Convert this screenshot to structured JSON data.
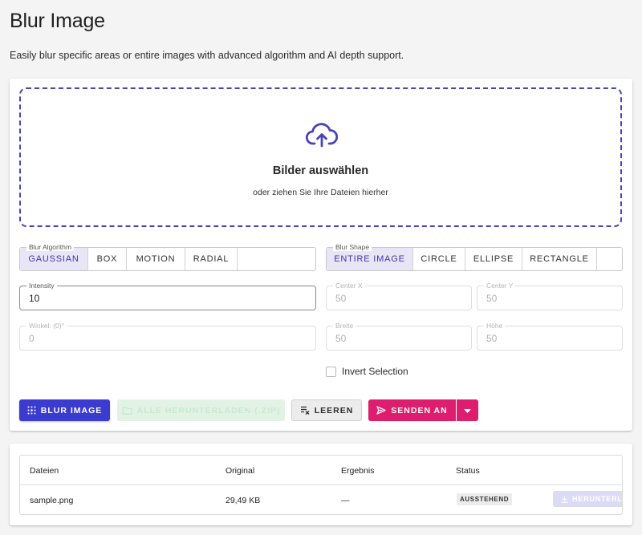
{
  "header": {
    "title": "Blur Image",
    "description": "Easily blur specific areas or entire images with advanced algorithm and AI depth support."
  },
  "dropzone": {
    "title": "Bilder auswählen",
    "subtitle": "oder ziehen Sie Ihre Dateien hierher",
    "icon": "cloud-upload-icon"
  },
  "algorithm": {
    "legend": "Blur Algorithm",
    "options": [
      "GAUSSIAN",
      "BOX",
      "MOTION",
      "RADIAL"
    ],
    "selected": "GAUSSIAN"
  },
  "shape": {
    "legend": "Blur Shape",
    "options": [
      "ENTIRE IMAGE",
      "CIRCLE",
      "ELLIPSE",
      "RECTANGLE"
    ],
    "selected": "ENTIRE IMAGE"
  },
  "fields": {
    "intensity": {
      "label": "Intensity",
      "value": "10"
    },
    "center_x": {
      "label": "Center X",
      "value": "50"
    },
    "center_y": {
      "label": "Center Y",
      "value": "50"
    },
    "angle": {
      "label": "Winkel: (0)°",
      "value": "0"
    },
    "width": {
      "label": "Breite",
      "value": "50"
    },
    "height": {
      "label": "Höhe",
      "value": "50"
    }
  },
  "invert": {
    "label": "Invert Selection",
    "checked": false
  },
  "actions": {
    "blur_label": "BLUR IMAGE",
    "download_all_label": "ALLE HERUNTERLADEN (.ZIP)",
    "clear_label": "LEEREN",
    "send_label": "SENDEN AN"
  },
  "table": {
    "headers": [
      "Dateien",
      "Original",
      "Ergebnis",
      "Status"
    ],
    "rows": [
      {
        "file": "sample.png",
        "original": "29,49 KB",
        "result": "—",
        "status": "AUSSTEHEND",
        "download_label": "HERUNTERLADEN"
      }
    ]
  },
  "colors": {
    "primary": "#3c3bd0",
    "send": "#dd1d6d",
    "zip_disabled": "#e2f3e6",
    "dropzone_border": "#4a43b8"
  }
}
